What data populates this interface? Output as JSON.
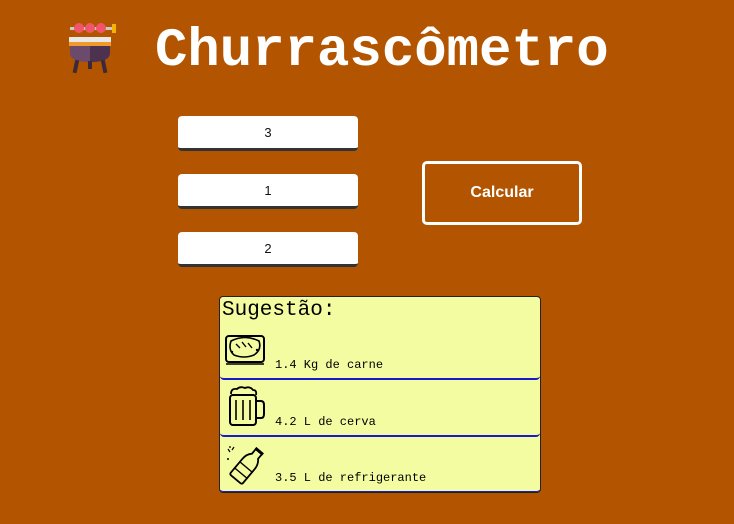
{
  "header": {
    "title": "Churrascômetro",
    "logo_icon": "grill-icon"
  },
  "inputs": {
    "adults": "3",
    "kids": "1",
    "duration": "2"
  },
  "actions": {
    "calculate_label": "Calcular"
  },
  "result": {
    "title": "Sugestão:",
    "items": [
      {
        "icon": "meat-icon",
        "text": "1.4 Kg de carne"
      },
      {
        "icon": "beer-mug-icon",
        "text": "4.2 L de cerva"
      },
      {
        "icon": "soda-bottle-icon",
        "text": "3.5 L de refrigerante"
      }
    ]
  },
  "colors": {
    "background": "#b35500",
    "result_background": "#f4fca2",
    "row_separator": "#1a1acc",
    "text_light": "#ffffff"
  }
}
